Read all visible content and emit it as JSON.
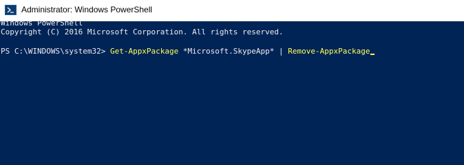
{
  "window": {
    "title": "Administrator: Windows PowerShell",
    "icon": "powershell-icon"
  },
  "console": {
    "banner_line1": "Windows PowerShell",
    "banner_line2": "Copyright (C) 2016 Microsoft Corporation. All rights reserved.",
    "prompt": "PS C:\\WINDOWS\\system32> ",
    "command_name": "Get-AppxPackage",
    "command_arg": " *Microsoft.SkypeApp* | ",
    "pipe_command": "Remove-AppxPackage"
  },
  "colors": {
    "background": "#012456",
    "text": "#eeedf0",
    "command": "#ffff5c"
  }
}
